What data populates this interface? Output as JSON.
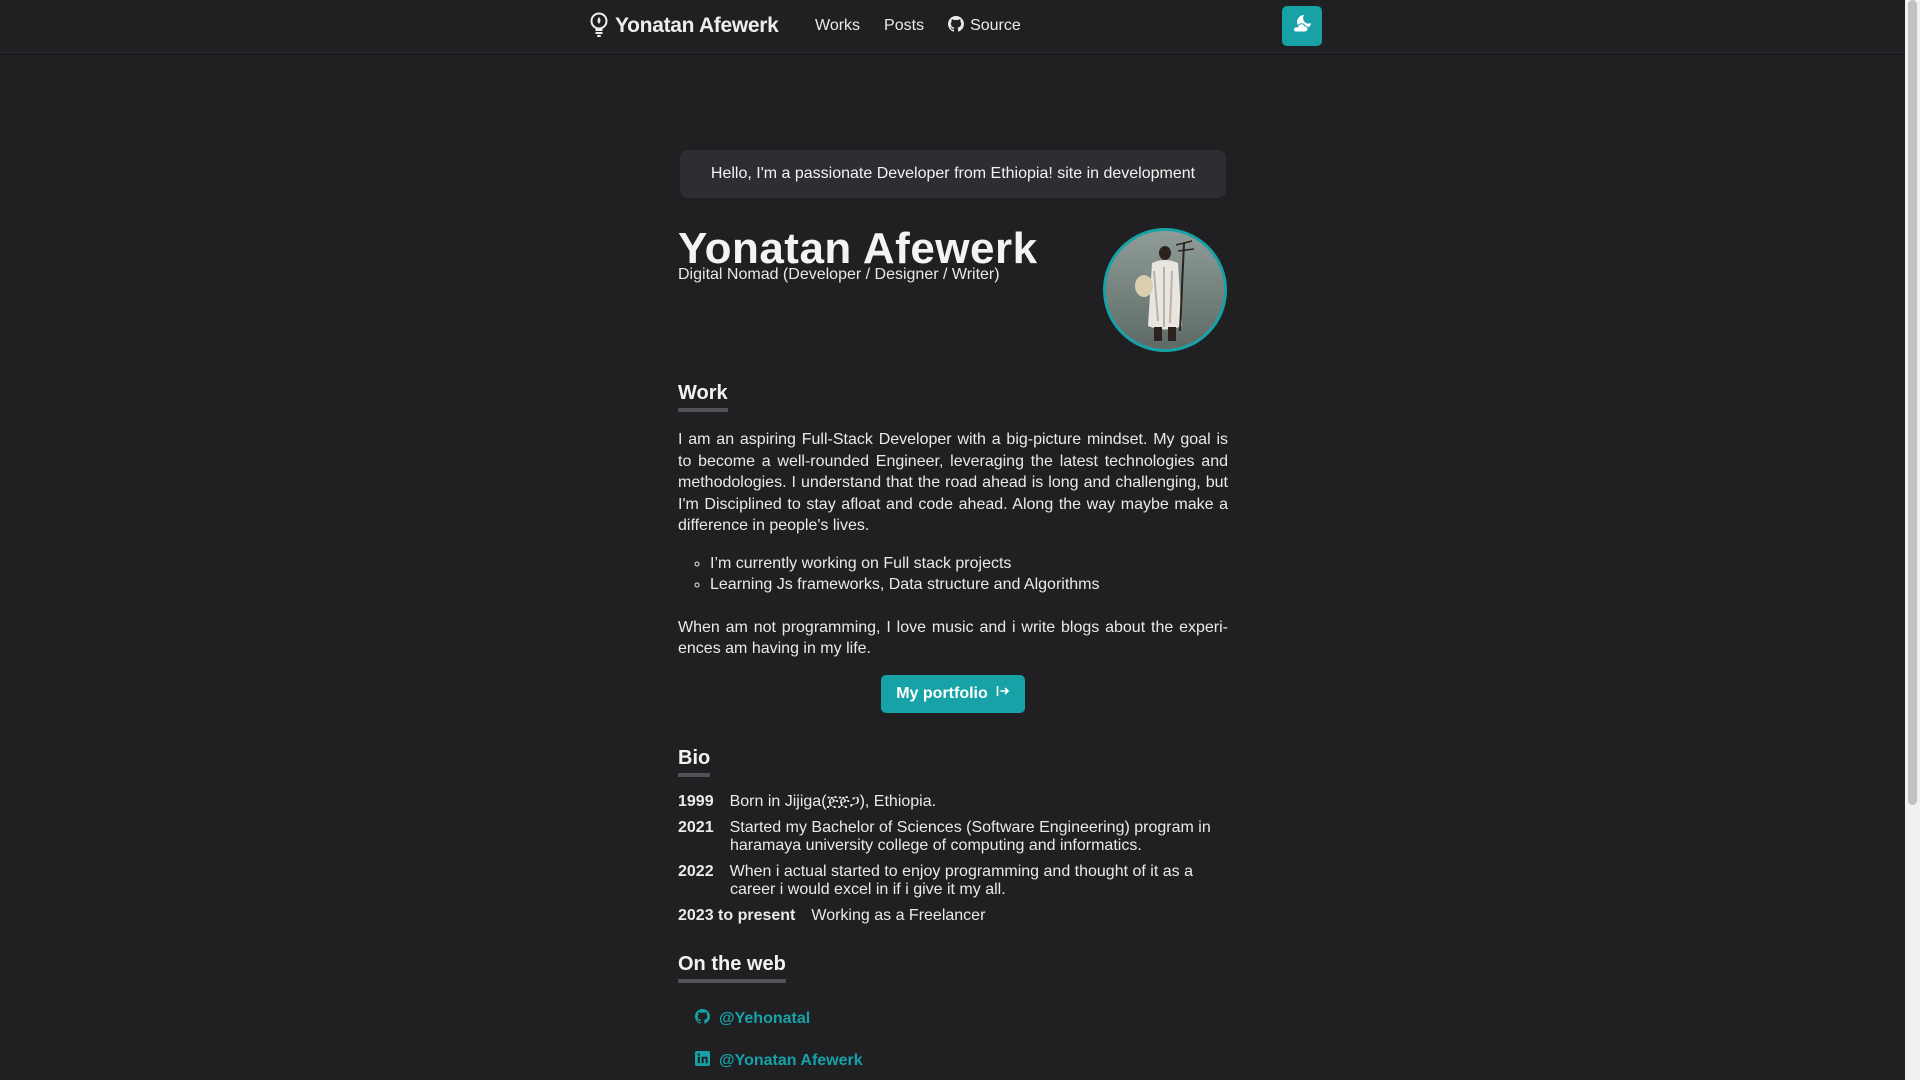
{
  "navbar": {
    "logo_text": "Yonatan Afewerk",
    "links": [
      {
        "label": "Works"
      },
      {
        "label": "Posts"
      },
      {
        "label": "Source",
        "icon": "github-icon"
      }
    ],
    "theme_toggle_icon": "moon-cloud-icon"
  },
  "hello": "Hello, I'm a passionate Developer from Ethiopia! site in development",
  "profile": {
    "name": "Yonatan Afewerk",
    "subtitle": "Digital Nomad (Developer / Designer / Writer)"
  },
  "work": {
    "heading": "Work",
    "paragraph": "I am an aspiring Full-Stack Developer with a big-picture mindset. My goal is to become a well-rounded Engineer, leveraging the latest technologies and methodologies. I understand that the road ahead is long and challenging, but I'm Disciplined to stay afloat and code ahead. Along the way maybe make a difference in people's lives.",
    "bullets": [
      "I’m currently working on Full stack projects",
      "Learning Js frameworks, Data structure and Algorithms"
    ],
    "paragraph2": "When am not programming, I love music and i write blogs about the experi­ences am having in my life.",
    "portfolio_button": "My portfolio"
  },
  "bio": {
    "heading": "Bio",
    "entries": [
      {
        "year": "1999",
        "text": "Born in Jijiga(ጅጅጋ), Ethiopia."
      },
      {
        "year": "2021",
        "text": "Started my Bachelor of Sciences (Software Engineering) program in haramaya university college of computing and informatics."
      },
      {
        "year": "2022",
        "text": "When i actual started to enjoy programming and thought of it as a career i would excel in if i give it my all."
      },
      {
        "year": "2023 to present",
        "text": "Working as a Freelancer"
      }
    ]
  },
  "web": {
    "heading": "On the web",
    "links": [
      {
        "label": "@Yehonatal",
        "icon": "github-icon"
      },
      {
        "label": "@Yonatan Afewerk",
        "icon": "linkedin-icon"
      }
    ]
  },
  "colors": {
    "background": "#202023",
    "accent": "#17a2a7",
    "hello_box": "#2e2e32",
    "text": "#eaeaea"
  }
}
